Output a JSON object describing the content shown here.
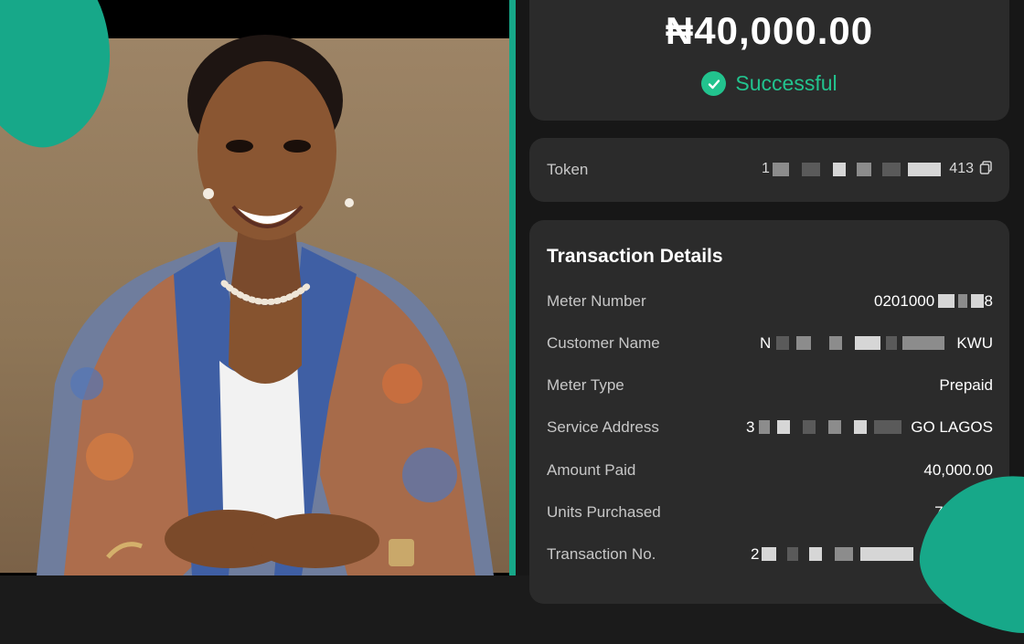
{
  "receipt": {
    "amount": "₦40,000.00",
    "status": "Successful",
    "token": {
      "label": "Token",
      "value_visible_start": "1",
      "value_visible_end": "413"
    },
    "details_title": "Transaction Details",
    "details": [
      {
        "label": "Meter Number",
        "value": "0201000",
        "masked_suffix": "8"
      },
      {
        "label": "Customer Name",
        "value": "N",
        "masked_suffix": "KWU"
      },
      {
        "label": "Meter Type",
        "value": "Prepaid"
      },
      {
        "label": "Service Address",
        "value": "3",
        "masked_suffix": "GO LAGOS"
      },
      {
        "label": "Amount Paid",
        "value": "40,000.00"
      },
      {
        "label": "Units Purchased",
        "value": "72"
      },
      {
        "label": "Transaction No.",
        "value": "2"
      }
    ]
  },
  "colors": {
    "accent": "#17a889",
    "success": "#22c38e",
    "card": "#2b2b2b",
    "background": "#171717"
  },
  "icons": {
    "status": "check-circle-icon",
    "copy": "copy-icon"
  }
}
